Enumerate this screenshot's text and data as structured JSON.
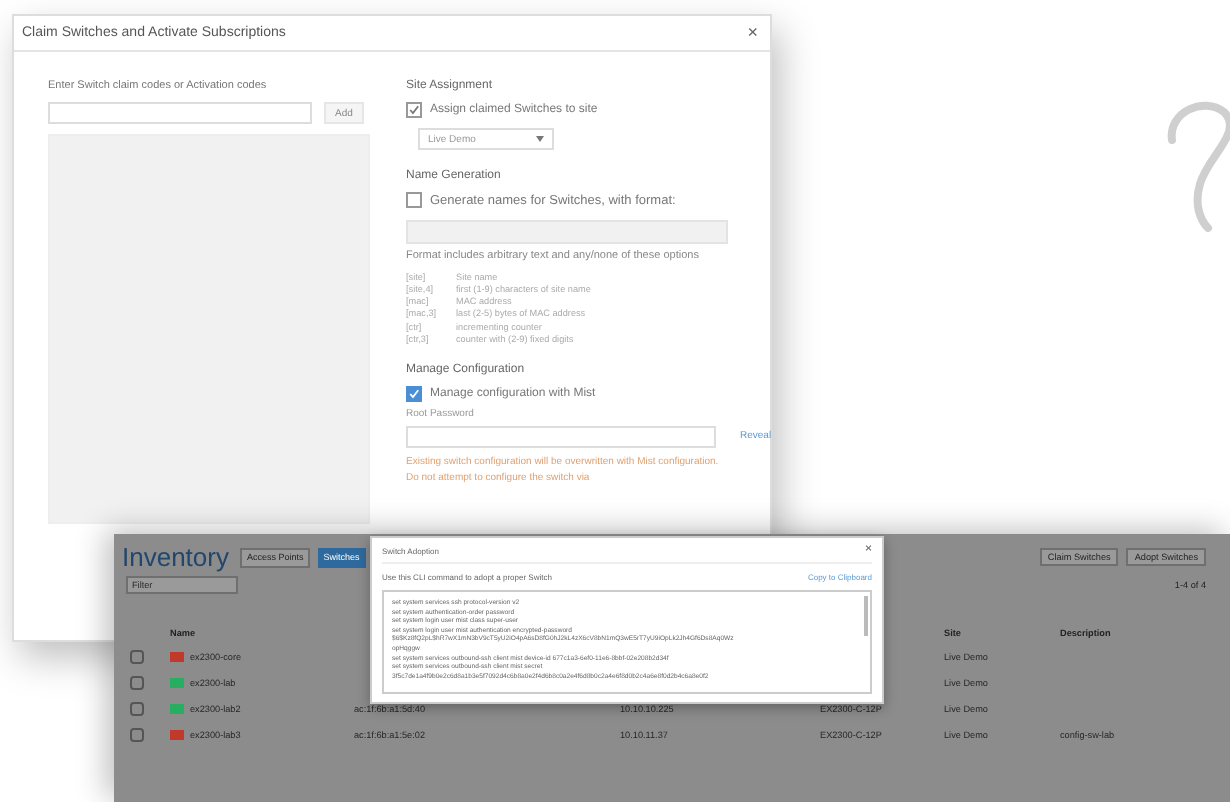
{
  "dialog": {
    "title": "Claim Switches and Activate Subscriptions",
    "close": "×",
    "codes": {
      "label": "Enter Switch claim codes or Activation codes",
      "add_button": "Add"
    },
    "site_assignment": {
      "heading": "Site Assignment",
      "checkbox": {
        "label": "Assign claimed Switches to site",
        "checked": true,
        "kind": "plain"
      },
      "site": "Live Demo"
    },
    "name_generation": {
      "heading": "Name Generation",
      "checkbox": {
        "label": "Generate names for Switches, with format:",
        "checked": false,
        "kind": "plain"
      },
      "description": "Format includes arbitrary text and any/none of these options",
      "options": [
        {
          "token": "[site]",
          "meaning": "Site name"
        },
        {
          "token": "[site,4]",
          "meaning": "first (1-9) characters of site name"
        },
        {
          "token": "[mac]",
          "meaning": "MAC address"
        },
        {
          "token": "[mac,3]",
          "meaning": "last (2-5) bytes of MAC address"
        },
        {
          "token": "[ctr]",
          "meaning": "incrementing counter"
        },
        {
          "token": "[ctr,3]",
          "meaning": "counter with (2-9) fixed digits"
        }
      ]
    },
    "manage_configuration": {
      "heading": "Manage Configuration",
      "checkbox": {
        "label": "Manage configuration with Mist",
        "checked": true,
        "kind": "accent"
      },
      "password_label": "Root Password",
      "reveal_link": "Reveal",
      "warning": "Existing switch configuration will be overwritten with Mist configuration. Do not attempt to configure the switch via"
    }
  },
  "inventory": {
    "title": "Inventory",
    "tabs": [
      {
        "label": "Access Points",
        "selected": false
      },
      {
        "label": "Switches",
        "selected": true
      }
    ],
    "filter": {
      "placeholder": "Filter"
    },
    "buttons": [
      "Claim Switches",
      "Adopt Switches"
    ],
    "pager": "1-4 of 4",
    "columns": [
      {
        "label": "Name",
        "kind": "name"
      },
      {
        "label": "Site",
        "kind": "site"
      },
      {
        "label": "Description",
        "kind": "description"
      }
    ],
    "rows": [
      {
        "selected": false,
        "color": "#c0392b",
        "name": "ex2300-core",
        "site": "Live Demo"
      },
      {
        "selected": false,
        "color": "#27ae60",
        "name": "ex2300-lab",
        "site": "Live Demo"
      },
      {
        "selected": false,
        "color": "#27ae60",
        "name": "ex2300-lab2",
        "mac": "ac:1f:6b:a1:5d:40",
        "ip": "10.10.10.225",
        "model": "EX2300-C-12P",
        "site": "Live Demo"
      },
      {
        "selected": false,
        "color": "#c0392b",
        "name": "ex2300-lab3",
        "mac": "ac:1f:6b:a1:5e:02",
        "ip": "10.10.11.37",
        "model": "EX2300-C-12P",
        "site": "Live Demo",
        "description": "config-sw-lab"
      }
    ]
  },
  "adoption": {
    "title": "Switch Adoption",
    "close": "×",
    "hint": "Use this CLI command to adopt a proper Switch",
    "copy_link": "Copy to Clipboard",
    "commands": [
      "set system services ssh protocol-version v2",
      "set system authentication-order password",
      "set system login user mist class super-user",
      "set system login user mist authentication encrypted-password",
      "$6$Kz8fQ2pL$hR7wX1mN3bV9cT5yU2iO4pA6sD8fG0hJ2kL4zX6cV8bN1mQ3wE5rT7yU9iOpLk2Jh4Gf6Ds8Aq0Wz",
      "opHqggw",
      "set system services outbound-ssh client mist device-id 677c1a3-6ef0-11e6-8bbf-02e208b2d34f",
      "set system services outbound-ssh client mist secret",
      "3f5c7de1a4f9b0e2c6d8a1b3e5f7092d4c6b8a0e2f4d6b8c0a2e4f6d8b0c2a4e6f8d0b2c4a6e8f0d2b4c6a8e0f2"
    ]
  }
}
